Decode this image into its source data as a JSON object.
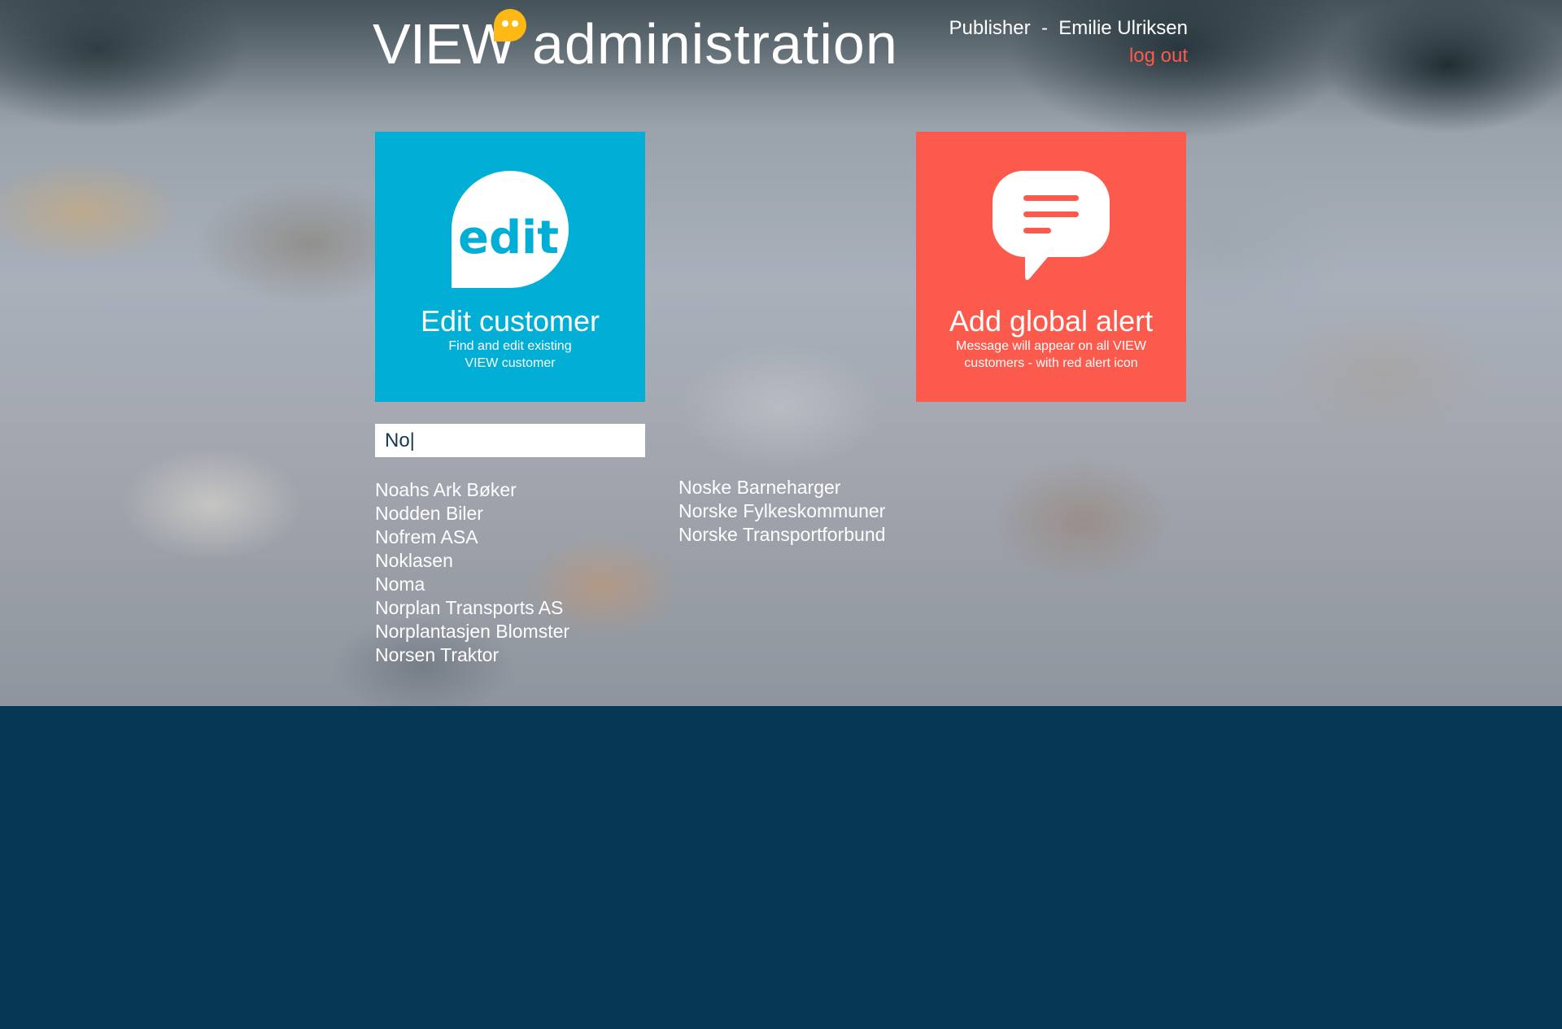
{
  "logo": {
    "brand": "VIEW",
    "product": "administration",
    "bubble_color": "#fdb813"
  },
  "user": {
    "role": "Publisher",
    "separator": "-",
    "name": "Emilie Ulriksen",
    "logout_label": "log out"
  },
  "tiles": {
    "edit": {
      "icon_text": "edit",
      "icon": "edit-speech-bubble-icon",
      "title": "Edit customer",
      "description": "Find and edit existing VIEW customer",
      "color": "#00aed6"
    },
    "alert": {
      "icon": "message-speech-bubble-icon",
      "title": "Add global alert",
      "description": "Message will appear on all VIEW customers - with red alert icon",
      "color": "#fd5a4e"
    }
  },
  "search": {
    "value": "No|",
    "placeholder": ""
  },
  "results": {
    "column1": [
      "Noahs Ark Bøker",
      "Nodden Biler",
      "Nofrem ASA",
      "Noklasen",
      "Noma",
      "Norplan Transports AS",
      "Norplantasjen Blomster",
      "Norsen Traktor"
    ],
    "column2": [
      "Noske Barneharger",
      "Norske Fylkeskommuner",
      "Norske Transportforbund"
    ]
  },
  "colors": {
    "footer_background": "#063856",
    "logout": "#fd5a4e"
  }
}
